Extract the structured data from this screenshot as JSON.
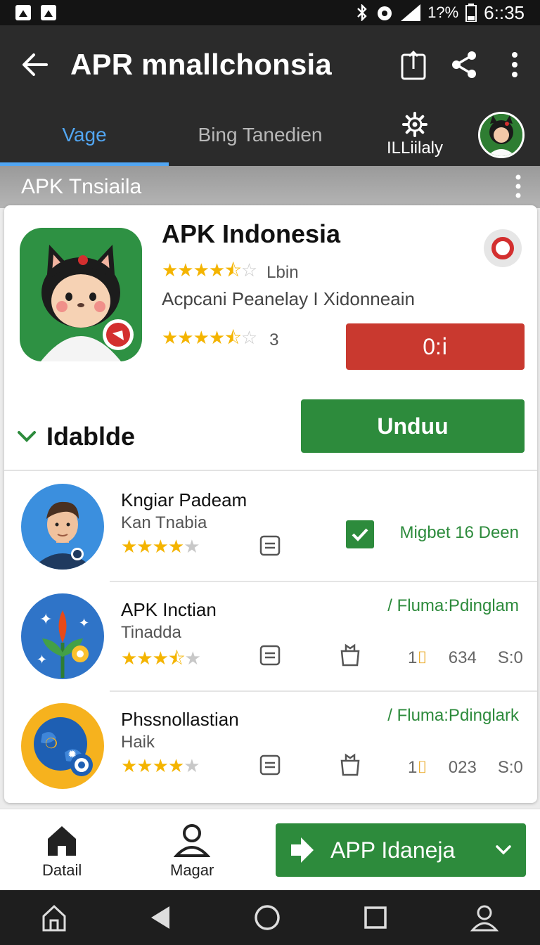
{
  "status_bar": {
    "battery": "1?%",
    "time": "6::35"
  },
  "app_bar": {
    "title": "APR mnallchonsia"
  },
  "tabs": {
    "tab1": "Vage",
    "tab2": "Bing Tanedien",
    "tab3": "ILLiilaly"
  },
  "section": {
    "title": "APK Tnsiaila"
  },
  "app": {
    "name": "APK Indonesia",
    "rating_label": "Lbin",
    "rating_1": 4.5,
    "publisher": "Acpcani Peanelay I Xidonneain",
    "rating_2": 4.5,
    "rating_2_count": "3",
    "red_button": "0:ⅰ",
    "download_button": "Unduu"
  },
  "collapsible": {
    "label": "Idablde"
  },
  "list": [
    {
      "title": "Kngiar Padeam",
      "subtitle": "Kan Tnabia",
      "rating": 4,
      "right_text": "Migbet 16 Deen"
    },
    {
      "title": "APK Inctian",
      "subtitle": "Tinadda",
      "rating": 3.5,
      "right_text": "/ Fluma:Pdinglam",
      "num1": "1",
      "num2": "634",
      "num3": "S:0"
    },
    {
      "title": "Phssnollastian",
      "subtitle": "Haik",
      "rating": 4,
      "right_text": "/ Fluma:Pdinglark",
      "num1": "1",
      "num2": "023",
      "num3": "S:0"
    }
  ],
  "bottom_nav": {
    "item1": "Datail",
    "item2": "Magar",
    "cta": "APP Idaneja"
  },
  "colors": {
    "accent_blue": "#52a6f2",
    "primary_green": "#2d8b3c",
    "danger_red": "#c9392f",
    "star_gold": "#f4b400"
  }
}
